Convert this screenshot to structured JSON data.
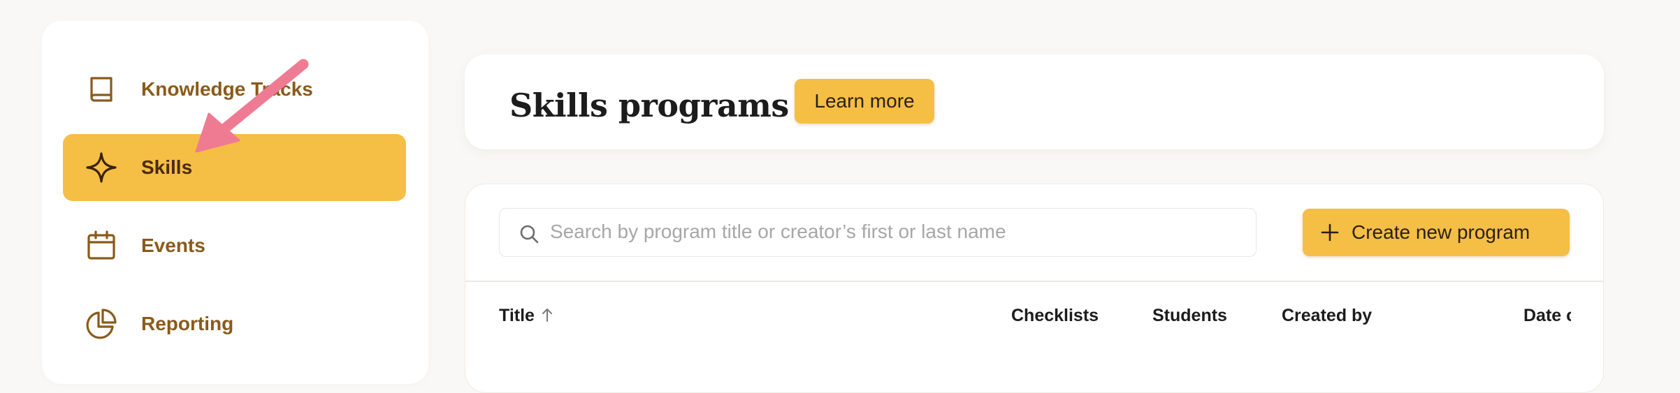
{
  "sidebar": {
    "items": [
      {
        "label": "Knowledge Tracks",
        "icon": "book-icon",
        "active": false
      },
      {
        "label": "Skills",
        "icon": "sparkle-icon",
        "active": true
      },
      {
        "label": "Events",
        "icon": "calendar-icon",
        "active": false
      },
      {
        "label": "Reporting",
        "icon": "pie-chart-icon",
        "active": false
      }
    ]
  },
  "header": {
    "title": "Skills programs",
    "learn_more_label": "Learn more"
  },
  "toolbar": {
    "search_placeholder": "Search by program title or creator’s first or last name",
    "search_value": "",
    "create_label": "Create new program"
  },
  "table": {
    "columns": [
      {
        "label": "Title",
        "sorted": "asc"
      },
      {
        "label": "Checklists"
      },
      {
        "label": "Students"
      },
      {
        "label": "Created by"
      },
      {
        "label": "Date c"
      }
    ]
  },
  "colors": {
    "accent": "#f5be45",
    "nav_text": "#8a5a1a",
    "annotation_arrow": "#ef7b93"
  }
}
